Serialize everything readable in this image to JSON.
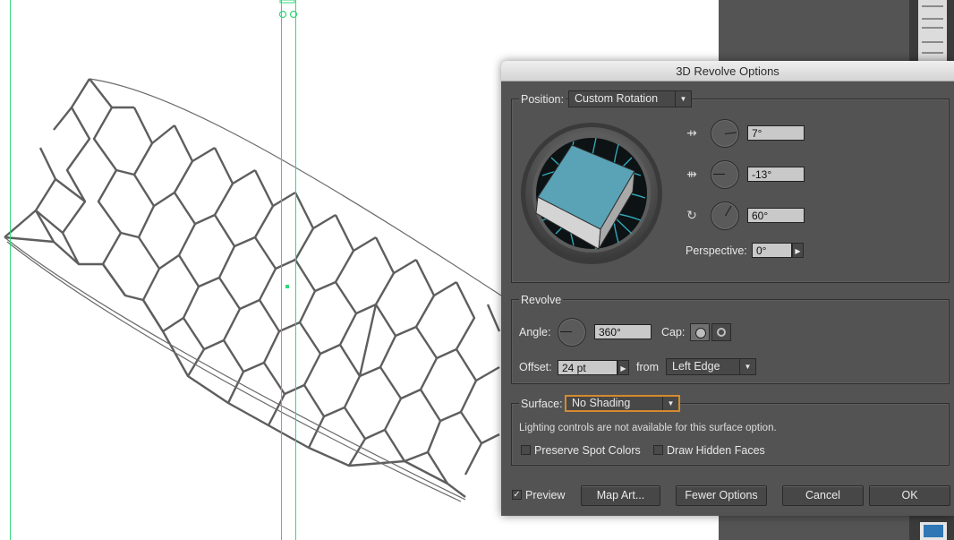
{
  "dialog": {
    "title": "3D Revolve Options"
  },
  "position": {
    "label": "Position:",
    "preset": "Custom Rotation",
    "x_rotation": "7°",
    "y_rotation": "-13°",
    "z_rotation": "60°",
    "perspective_label": "Perspective:",
    "perspective_value": "0°"
  },
  "revolve": {
    "title": "Revolve",
    "angle_label": "Angle:",
    "angle_value": "360°",
    "cap_label": "Cap:",
    "offset_label": "Offset:",
    "offset_value": "24 pt",
    "from_label": "from",
    "from_value": "Left Edge"
  },
  "surface": {
    "label": "Surface:",
    "value": "No Shading",
    "note": "Lighting controls are not available for this surface option.",
    "preserve_spot_label": "Preserve Spot Colors",
    "draw_hidden_label": "Draw Hidden Faces",
    "preserve_spot_checked": false,
    "draw_hidden_checked": false
  },
  "footer": {
    "preview_label": "Preview",
    "preview_checked": true,
    "map_art_label": "Map Art...",
    "fewer_options_label": "Fewer Options",
    "cancel_label": "Cancel",
    "ok_label": "OK"
  },
  "colors": {
    "dialog_bg": "#535353",
    "guide": "#35d77a",
    "cube_top": "#5aa3b7",
    "cube_side": "#d4d4d4",
    "track_grid": "#2fa9b8",
    "focus_outline": "#d58a2e"
  },
  "icons": [
    "x-axis-rotate-icon",
    "y-axis-rotate-icon",
    "z-axis-rotate-icon",
    "cap-on-icon",
    "cap-off-icon",
    "checkmark-icon",
    "dropdown-arrow-icon",
    "stepper-arrow-icon"
  ]
}
